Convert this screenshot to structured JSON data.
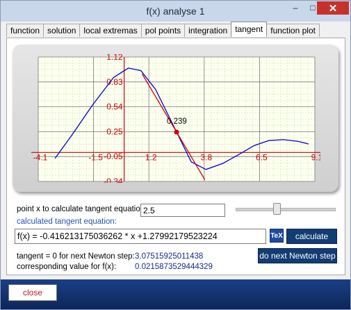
{
  "window": {
    "title": "f(x) analyse 1",
    "minimize": "–",
    "maximize": "□",
    "close": "✕"
  },
  "tabs": [
    {
      "label": "function"
    },
    {
      "label": "solution"
    },
    {
      "label": "local extremas"
    },
    {
      "label": "pol points"
    },
    {
      "label": "integration"
    },
    {
      "label": "tangent"
    },
    {
      "label": "function plot"
    }
  ],
  "chart_data": {
    "type": "line",
    "x_ticks": [
      "-4.1",
      "-1.5",
      "1.2",
      "3.8",
      "6.5",
      "9.1"
    ],
    "y_ticks": [
      "1.12",
      "0.83",
      "0.54",
      "0.25",
      "-0.05",
      "-0.34"
    ],
    "xlim": [
      -4.1,
      9.1
    ],
    "ylim": [
      -0.34,
      1.12
    ],
    "series": [
      {
        "curve": "function",
        "color": "#0000cc",
        "x": [
          -3.3,
          -2.5,
          -1.5,
          -0.5,
          0.2,
          0.8,
          1.5,
          2.5,
          3.2,
          3.9,
          4.7,
          5.5,
          6.2,
          6.9,
          7.6,
          8.3,
          8.8
        ],
        "y": [
          -0.07,
          0.2,
          0.56,
          0.88,
          0.99,
          0.96,
          0.74,
          0.24,
          -0.11,
          -0.2,
          -0.13,
          -0.02,
          0.08,
          0.14,
          0.15,
          0.13,
          0.1
        ]
      },
      {
        "curve": "tangent",
        "color": "#cc0000",
        "x": [
          0.86,
          3.85
        ],
        "y": [
          0.92,
          -0.32
        ]
      }
    ],
    "point": {
      "x": 2.5,
      "y": 0.239,
      "label": "0.239",
      "color": "#cc0000"
    },
    "grid": true,
    "background": "#fffff0",
    "grid_color": "#b8e8b8",
    "axis_color": "#cc0000"
  },
  "form": {
    "point_x_label": "point x to calculate tangent equation:",
    "point_x_value": "2.5",
    "equation_caption": "calculated tangent equation:",
    "equation_value": "f(x) = -0.416213175036262 * x +1.27992179523224",
    "tex_icon": "TeX",
    "calculate_label": "calculate",
    "newton_label": "tangent = 0 for next Newton step:",
    "newton_value": "3.07515925011438",
    "fx_label": "corresponding value for f(x):",
    "fx_value": "0.0215873529444329",
    "next_newton_label": "do next Newton step"
  },
  "footer": {
    "close_label": "close"
  }
}
